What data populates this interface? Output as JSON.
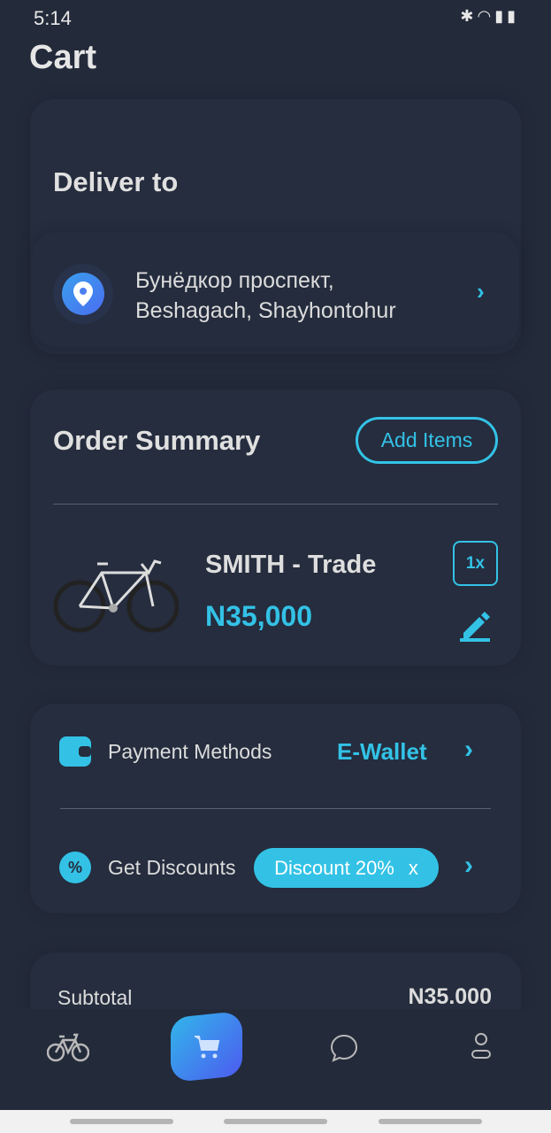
{
  "status_bar": {
    "time": "5:14",
    "icons": [
      "bluetooth-icon",
      "wifi-icon",
      "signal-icon",
      "battery-charging-icon"
    ]
  },
  "header": {
    "title": "Cart"
  },
  "deliver": {
    "title": "Deliver to",
    "address_line1": "Бунёдкор проспект,",
    "address_line2": "Beshagach, Shayhontohur"
  },
  "order": {
    "title": "Order Summary",
    "add_items_label": "Add Items",
    "item": {
      "name": "SMITH - Trade",
      "price": "N35,000",
      "quantity": "1x"
    }
  },
  "payment": {
    "label": "Payment Methods",
    "value": "E-Wallet"
  },
  "discount": {
    "label": "Get Discounts",
    "badge": "Discount 20%",
    "remove": "x"
  },
  "summary": {
    "subtotal_label": "Subtotal",
    "subtotal_value": "N35.000"
  },
  "nav": {
    "items": [
      "bike-icon",
      "cart-icon",
      "chat-icon",
      "profile-icon"
    ],
    "active": "cart"
  },
  "colors": {
    "accent": "#33c2e6",
    "background": "#232a3a"
  }
}
